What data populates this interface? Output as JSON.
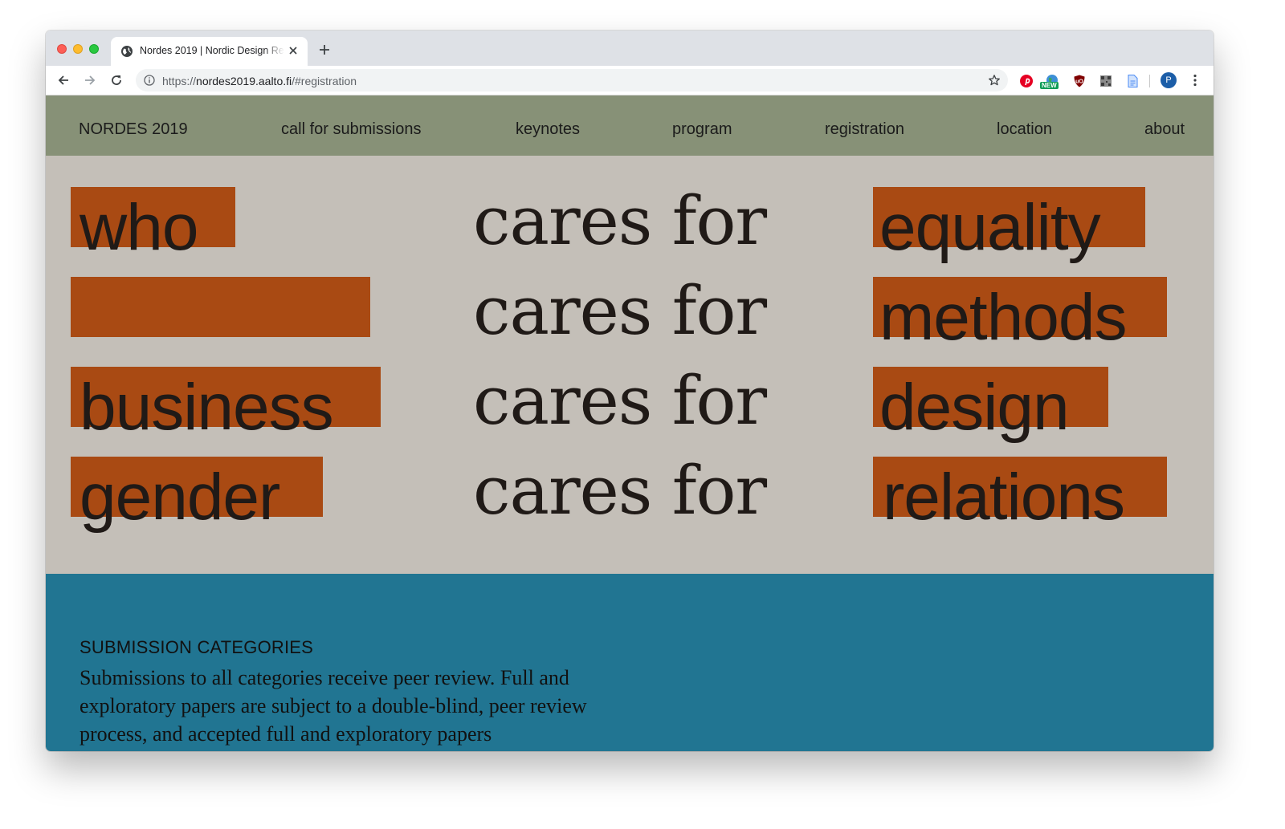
{
  "browser": {
    "tab_title": "Nordes 2019 | Nordic Design Research",
    "url_scheme": "https://",
    "url_host": "nordes2019.aalto.fi",
    "url_path": "/#registration",
    "extensions": [
      {
        "name": "pinterest-icon",
        "color": "#e60023"
      },
      {
        "name": "new-extension-icon",
        "badge": "NEW",
        "color": "#0f9d58"
      },
      {
        "name": "ublock-icon",
        "color": "#800000"
      },
      {
        "name": "qr-code-icon",
        "color": "#6d6d6d"
      },
      {
        "name": "docs-icon",
        "color": "#4a8af4"
      }
    ],
    "profile_initial": "P"
  },
  "nav": {
    "brand": "NORDES 2019",
    "links": [
      "call for submissions",
      "keynotes",
      "program",
      "registration",
      "location",
      "about"
    ]
  },
  "hero": {
    "left_words": [
      "who",
      "",
      "business",
      "gender"
    ],
    "middle_phrase": "cares for",
    "right_words": [
      "equality",
      "methods",
      "design",
      "relations"
    ],
    "highlight_color": "#a94a13",
    "background_color": "#c4bfb8"
  },
  "submission": {
    "heading": "SUBMISSION CATEGORIES",
    "body": "Submissions to all categories receive peer review. Full and exploratory papers are subject to a double-blind, peer review process, and accepted full and exploratory papers",
    "background_color": "#217592"
  }
}
